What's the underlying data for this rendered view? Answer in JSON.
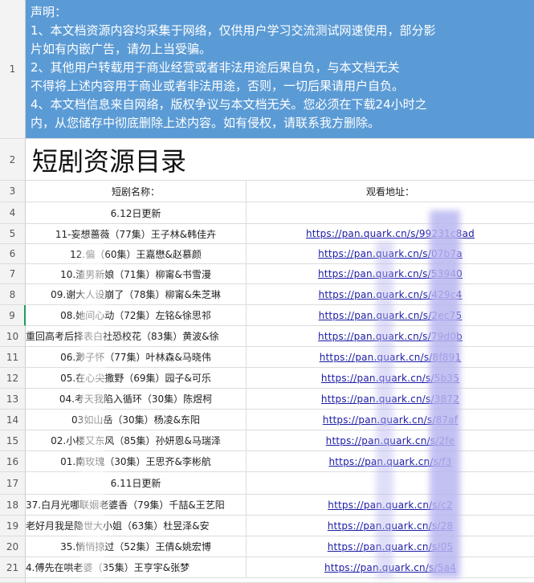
{
  "notice": {
    "lines": [
      "声明：",
      "1、本文档资源内容均采集于网络，仅供用户学习交流测试网速使用，部分影",
      "片如有内嵌广告，请勿上当受骗。",
      "2、其他用户转载用于商业经营或者非法用途后果自负，与本文档无关",
      "不得将上述内容用于商业或者非法用途，否则，一切后果请用户自负。",
      "4、本文档信息来自网络，版权争议与本文档无关。您必须在下载24小时之",
      "内，从您储存中彻底删除上述内容。如有侵权，请联系我方删除。"
    ]
  },
  "title": "短剧资源目录",
  "headers": {
    "name": "短剧名称：",
    "link": "观看地址："
  },
  "row_numbers": [
    "1",
    "2",
    "3",
    "4",
    "5",
    "6",
    "7",
    "8",
    "9",
    "10",
    "11",
    "12",
    "13",
    "14",
    "15",
    "16",
    "17",
    "18",
    "19",
    "20",
    "21",
    "22"
  ],
  "groups": [
    {
      "label": "6.12日更新",
      "items": [
        {
          "name": "11-妄想蔷薇（77集）王子林&韩佳卉",
          "link": "https://pan.quark.cn/s/99231c8ad"
        },
        {
          "name": "12.偏（60集）王嘉懋&赵慕颜",
          "link": "https://pan.quark.cn/s/07b7a"
        },
        {
          "name": "10.渣男新娘（71集）柳甯&书雪漫",
          "link": "https://pan.quark.cn/s/53940"
        },
        {
          "name": "09.谢大人设崩了（78集）柳甯&朱芝琳",
          "link": "https://pan.quark.cn/s/429c4"
        },
        {
          "name": "08.她间心动（72集）左铭&徐思祁",
          "link": "https://pan.quark.cn/s/2ec75"
        },
        {
          "name": "重回高考后择表白社恐校花（83集）黄波&徐",
          "link": "https://pan.quark.cn/s/79d0b"
        },
        {
          "name": "06.渺子怀（77集）叶林森&马晓伟",
          "link": "https://pan.quark.cn/s/8f891"
        },
        {
          "name": "05.在心尖撒野（69集）园子&可乐",
          "link": "https://pan.quark.cn/s/5b35"
        },
        {
          "name": "04.考天我陷入循环（30集）陈煜柯",
          "link": "https://pan.quark.cn/s/3872"
        },
        {
          "name": "03如山岳（30集）杨凌&东阳",
          "link": "https://pan.quark.cn/s/87af"
        },
        {
          "name": "02.小楼又东风（85集）孙妍恩&马瑞泽",
          "link": "https://pan.quark.cn/s/2fe"
        },
        {
          "name": "01.南玫瑰（30集）王思齐&李彬航",
          "link": "https://pan.quark.cn/s/f3"
        }
      ]
    },
    {
      "label": "6.11日更新",
      "items": [
        {
          "name": "37.白月光哪联姻老婆香（79集）千喆&王艺阳",
          "link": "https://pan.quark.cn/s/c2"
        },
        {
          "name": "老好月我是隐世大小姐（63集）杜昱泽&安",
          "link": "https://pan.quark.cn/s/28"
        },
        {
          "name": "35.悄悄掠过（52集）王倩&姚宏博",
          "link": "https://pan.quark.cn/s/05"
        },
        {
          "name": "4.傅先在哄老婆（35集）王亨宇&张梦",
          "link": "https://pan.quark.cn/s/5a4"
        }
      ]
    }
  ]
}
